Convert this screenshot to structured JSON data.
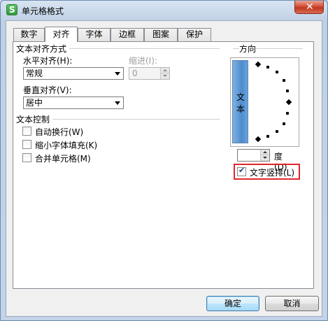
{
  "window": {
    "title": "单元格格式",
    "app_icon_letter": "S",
    "close_symbol": "✕"
  },
  "tabs": [
    {
      "label": "数字",
      "active": false
    },
    {
      "label": "对齐",
      "active": true
    },
    {
      "label": "字体",
      "active": false
    },
    {
      "label": "边框",
      "active": false
    },
    {
      "label": "图案",
      "active": false
    },
    {
      "label": "保护",
      "active": false
    }
  ],
  "alignment": {
    "section_title": "文本对齐方式",
    "horizontal": {
      "label": "水平对齐(H):",
      "value": "常规"
    },
    "indent": {
      "label": "缩进(I):",
      "value": "0"
    },
    "vertical": {
      "label": "垂直对齐(V):",
      "value": "居中"
    }
  },
  "text_control": {
    "section_title": "文本控制",
    "options": [
      {
        "label": "自动换行(W)",
        "checked": false
      },
      {
        "label": "缩小字体填充(K)",
        "checked": false
      },
      {
        "label": "合并单元格(M)",
        "checked": false
      }
    ]
  },
  "orientation": {
    "section_title": "方向",
    "vertical_text_sample": "文本",
    "degree_value": "",
    "degree_label": "度(D)",
    "vertical_stack": {
      "label": "文字竖排(L)",
      "checked": true
    }
  },
  "buttons": {
    "ok": "确定",
    "cancel": "取消"
  },
  "colors": {
    "highlight": "#e0262d",
    "vertical_text_button": "#4e8ccc",
    "close_button": "#c0371e"
  }
}
